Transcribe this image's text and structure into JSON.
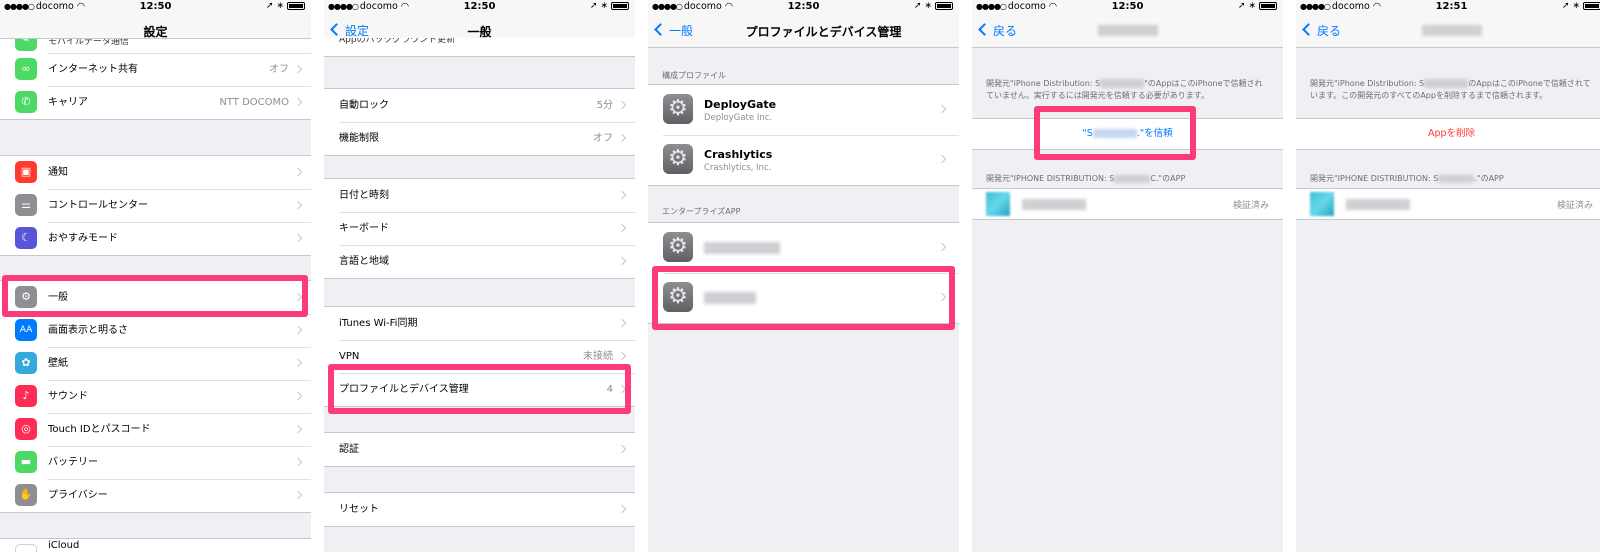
{
  "status_bar": {
    "dots": "●●●●○",
    "carrier": "docomo",
    "wifi_icon": "wifi-icon",
    "times": [
      "12:50",
      "12:50",
      "12:50",
      "12:50",
      "12:51"
    ],
    "right": "➚ ∗"
  },
  "screen1": {
    "title": "設定",
    "partial_top": "モバイルデータ通信",
    "rows": [
      {
        "label": "インターネット共有",
        "value": "オフ",
        "icon": "link-icon",
        "color": "#4cd964",
        "glyph": "∞"
      },
      {
        "label": "キャリア",
        "value": "NTT DOCOMO",
        "icon": "phone-icon",
        "color": "#4cd964",
        "glyph": "✆"
      },
      {
        "label": "通知",
        "value": "",
        "icon": "notifications-icon",
        "color": "#ff3b30",
        "glyph": "▣"
      },
      {
        "label": "コントロールセンター",
        "value": "",
        "icon": "control-center-icon",
        "color": "#8e8e93",
        "glyph": "⚌"
      },
      {
        "label": "おやすみモード",
        "value": "",
        "icon": "moon-icon",
        "color": "#5856d6",
        "glyph": "☾"
      },
      {
        "label": "一般",
        "value": "",
        "icon": "gear-icon",
        "color": "#8e8e93",
        "glyph": "⚙"
      },
      {
        "label": "画面表示と明るさ",
        "value": "",
        "icon": "display-icon",
        "color": "#007aff",
        "glyph": "AA"
      },
      {
        "label": "壁紙",
        "value": "",
        "icon": "wallpaper-icon",
        "color": "#34aadc",
        "glyph": "✿"
      },
      {
        "label": "サウンド",
        "value": "",
        "icon": "speaker-icon",
        "color": "#ff2d55",
        "glyph": "♪"
      },
      {
        "label": "Touch IDとパスコード",
        "value": "",
        "icon": "fingerprint-icon",
        "color": "#ff2d55",
        "glyph": "◎"
      },
      {
        "label": "バッテリー",
        "value": "",
        "icon": "battery-icon",
        "color": "#4cd964",
        "glyph": "▬"
      },
      {
        "label": "プライバシー",
        "value": "",
        "icon": "hand-icon",
        "color": "#8e8e93",
        "glyph": "✋"
      },
      {
        "label": "iCloud",
        "value": "",
        "icon": "icloud-icon",
        "color": "#ffffff",
        "glyph": "☁"
      }
    ]
  },
  "screen2": {
    "back": "設定",
    "title": "一般",
    "partial_top": "Appのバックグラウンド更新",
    "rows": [
      {
        "label": "自動ロック",
        "value": "5分"
      },
      {
        "label": "機能制限",
        "value": "オフ"
      },
      {
        "label": "日付と時刻",
        "value": ""
      },
      {
        "label": "キーボード",
        "value": ""
      },
      {
        "label": "言語と地域",
        "value": ""
      },
      {
        "label": "iTunes Wi-Fi同期",
        "value": ""
      },
      {
        "label": "VPN",
        "value": "未接続"
      },
      {
        "label": "プロファイルとデバイス管理",
        "value": "4"
      },
      {
        "label": "認証",
        "value": ""
      },
      {
        "label": "リセット",
        "value": ""
      }
    ]
  },
  "screen3": {
    "back": "一般",
    "title": "プロファイルとデバイス管理",
    "section_config": "構成プロファイル",
    "section_enterprise": "エンタープライズAPP",
    "profiles": [
      {
        "title": "DeployGate",
        "subtitle": "DeployGate Inc."
      },
      {
        "title": "Crashlytics",
        "subtitle": "Crashlytics, Inc."
      }
    ]
  },
  "screen4": {
    "back": "戻る",
    "footer_pre": "開発元\"iPhone Distribution: S",
    "footer_post": "\"のAppはこのiPhoneで信頼されていません。実行するには開発元を信頼する必要があります。",
    "trust_pre": "\"S",
    "trust_post": ".\"を信頼",
    "apps_header_pre": "開発元\"IPHONE DISTRIBUTION: S",
    "apps_header_post": "C.\"のAPP",
    "verified": "検証済み"
  },
  "screen5": {
    "back": "戻る",
    "footer_pre": "開発元\"iPhone Distribution: S",
    "footer_post": "のAppはこのiPhoneで信頼されています。この開発元のすべてのAppを削除するまで信頼されます。",
    "delete": "Appを削除",
    "apps_header_pre": "開発元\"IPHONE DISTRIBUTION: S",
    "apps_header_post": ".\"のAPP",
    "verified": "検証済み"
  },
  "colors": {
    "highlight": "#fb3c78",
    "link": "#007aff",
    "destructive": "#ff3b30"
  }
}
